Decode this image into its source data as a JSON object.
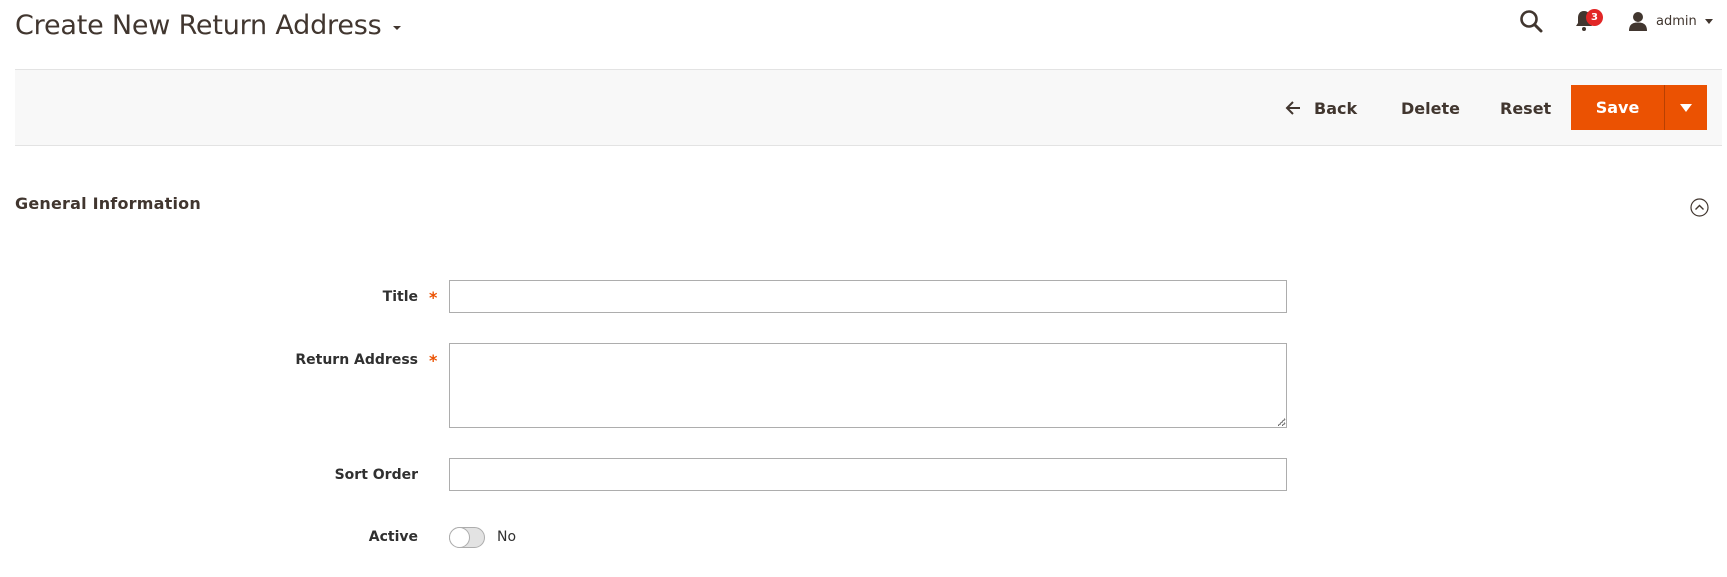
{
  "header": {
    "title": "Create New Return Address",
    "notifications_count": "3",
    "user_name": "admin",
    "icons": {
      "search": "search-icon",
      "notifications": "bell-icon",
      "user": "user-icon"
    }
  },
  "toolbar": {
    "back_label": "Back",
    "delete_label": "Delete",
    "reset_label": "Reset",
    "save_label": "Save"
  },
  "section": {
    "title": "General Information",
    "collapse_icon": "chevron-up-circle-icon"
  },
  "form": {
    "fields": [
      {
        "label": "Title",
        "required": true,
        "value": ""
      },
      {
        "label": "Return Address",
        "required": true,
        "value": ""
      },
      {
        "label": "Sort Order",
        "required": false,
        "value": ""
      },
      {
        "label": "Active",
        "required": false,
        "value": "No"
      }
    ],
    "required_marker": "*"
  },
  "colors": {
    "accent": "#eb5202",
    "badge": "#e22626",
    "text": "#41362f",
    "toolbar_bg": "#f8f8f8"
  }
}
